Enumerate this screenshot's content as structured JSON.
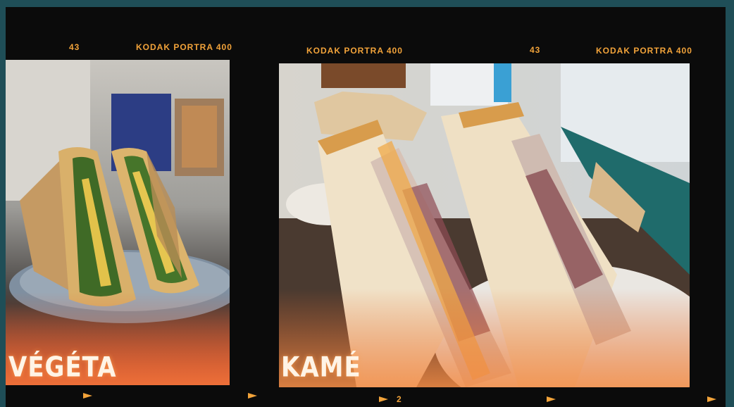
{
  "film": {
    "stock_label": "KODAK PORTRA 400",
    "frame_numbers": [
      "43",
      "43"
    ],
    "bottom_frame": "2"
  },
  "photos": [
    {
      "caption": "VÉGÉTA",
      "subject": "vegetable-sandwich-photo"
    },
    {
      "caption": "KAMÉ",
      "subject": "meat-sandwich-photo"
    }
  ],
  "colors": {
    "background": "#1f4e57",
    "film": "#0b0b0b",
    "film_text": "#f2a33a"
  }
}
